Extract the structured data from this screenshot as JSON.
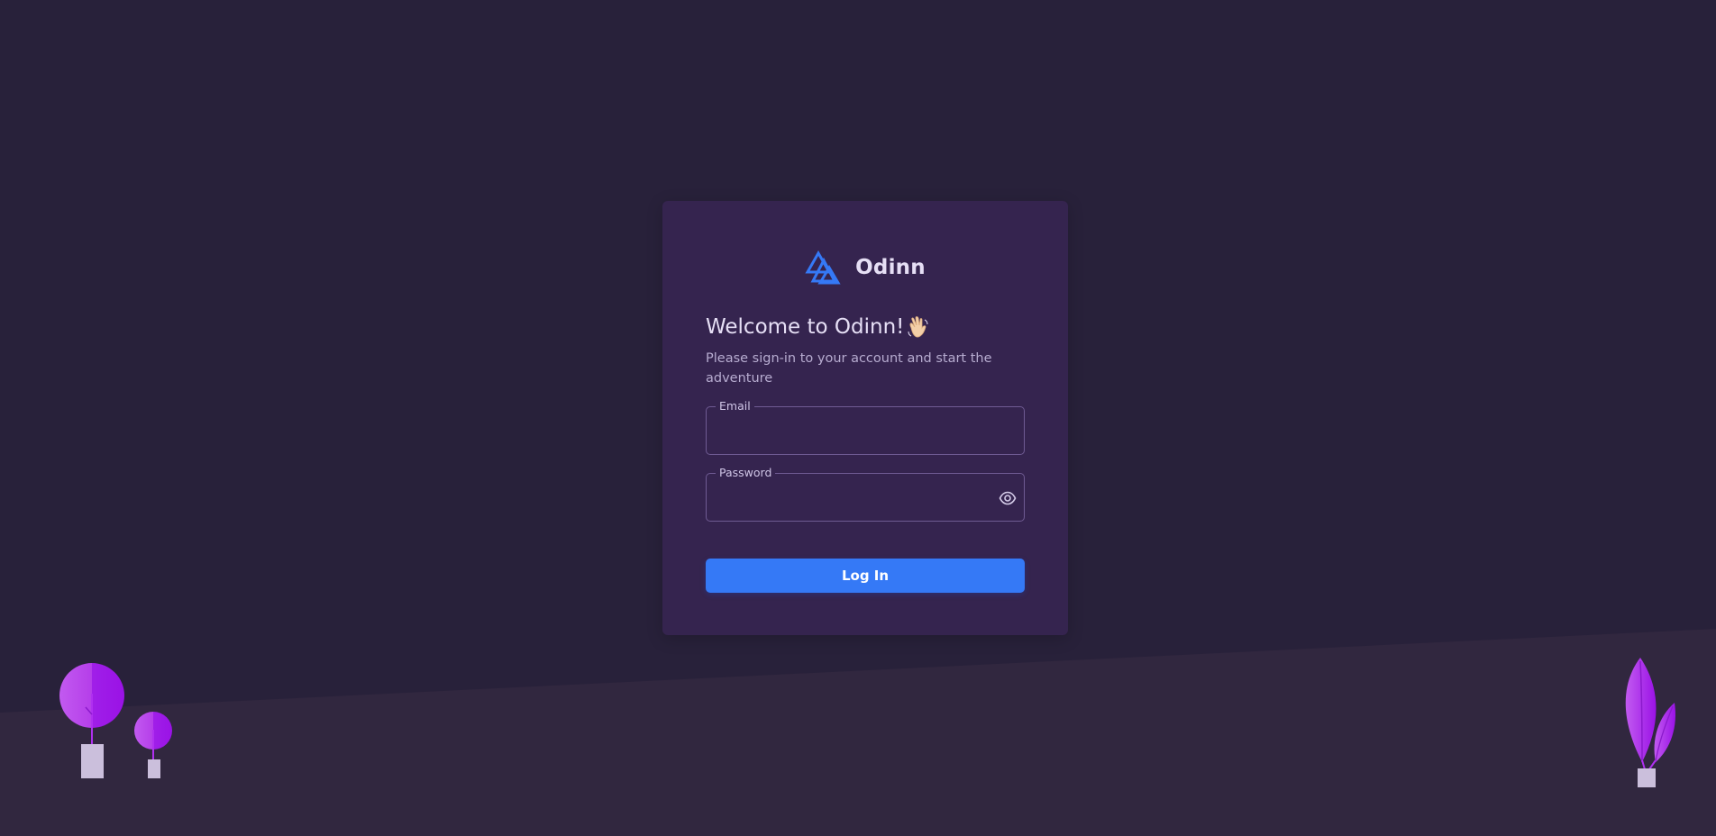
{
  "brand": {
    "name": "Odinn",
    "logo_icon": "valknut-triangle-icon",
    "accent_color": "#3579f6"
  },
  "login": {
    "welcome_title": "Welcome to Odinn!",
    "wave_icon": "waving-hand-icon",
    "subtitle": "Please sign-in to your account and start the adventure",
    "email_label": "Email",
    "email_value": "",
    "password_label": "Password",
    "password_value": "",
    "password_toggle_icon": "eye-icon",
    "submit_label": "Log In"
  },
  "theme": {
    "background": "#28213a",
    "card": "#35244f",
    "floor": "#31273f",
    "plant_color": "#a020f0"
  }
}
